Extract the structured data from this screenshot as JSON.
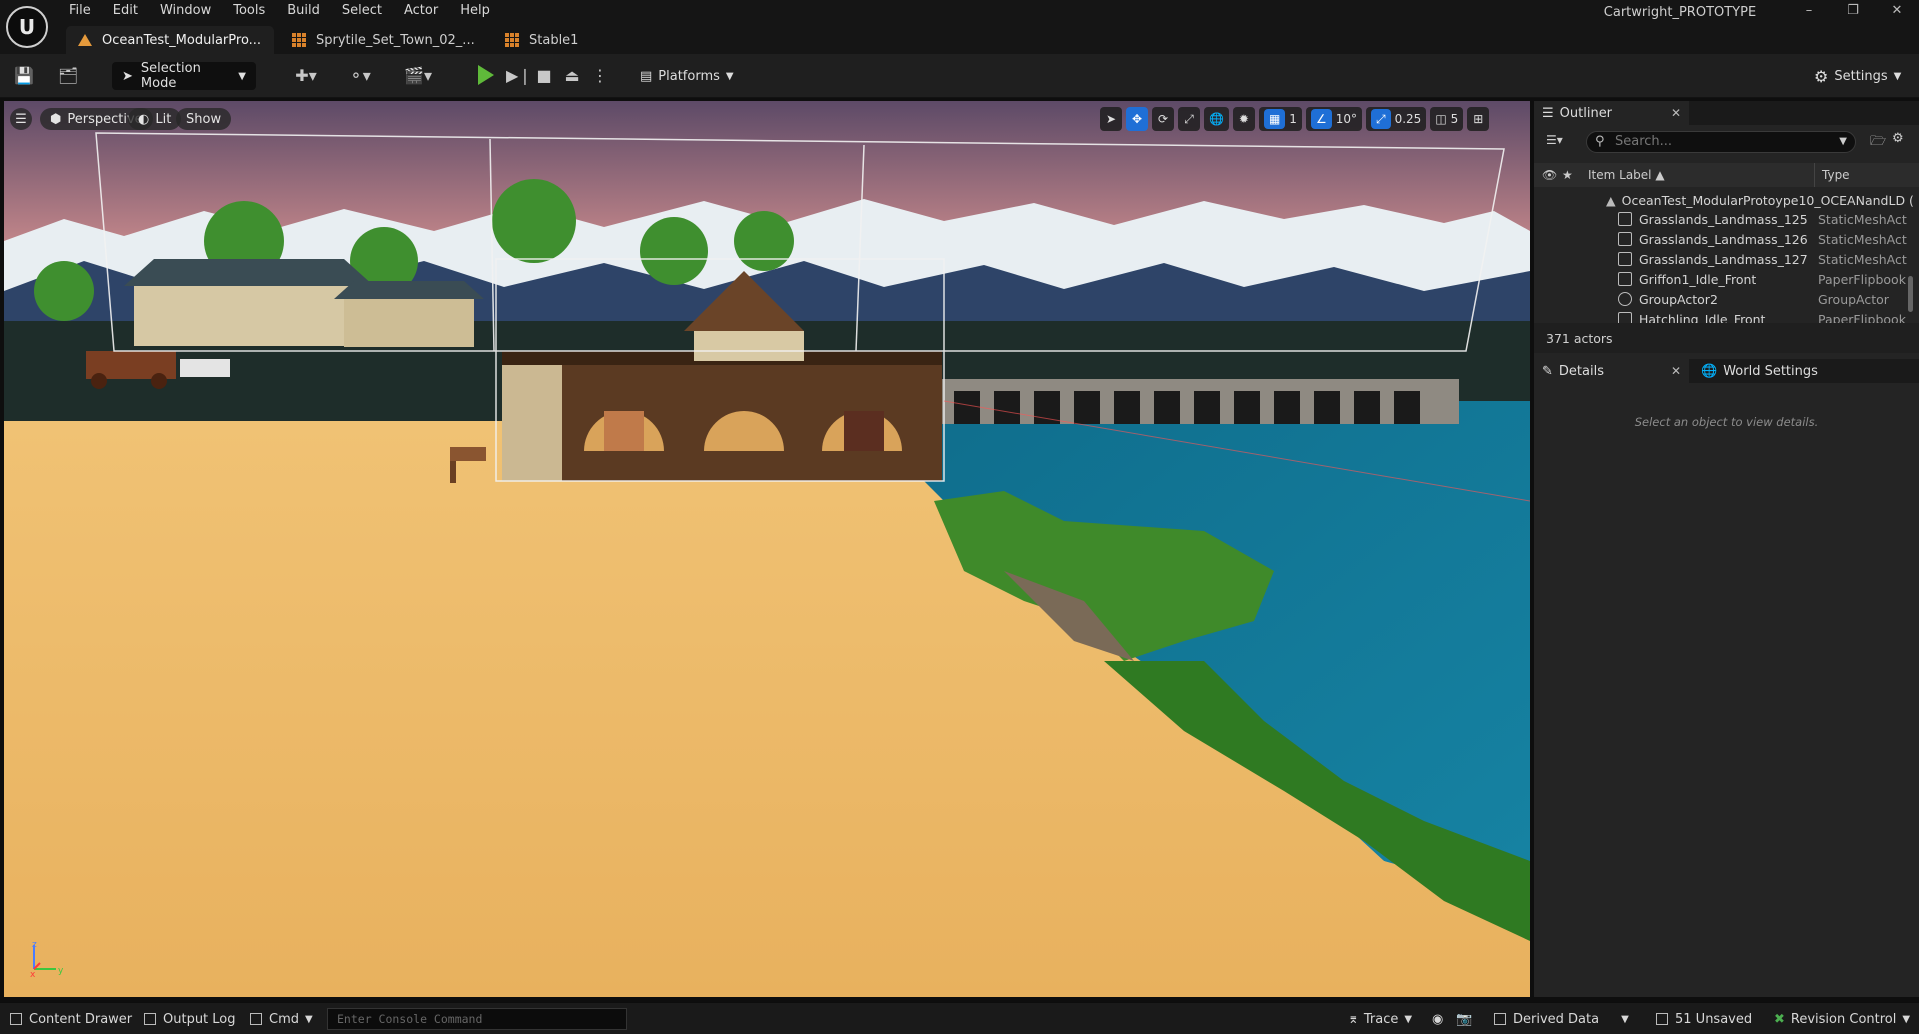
{
  "app": {
    "project_name": "Cartwright_PROTOTYPE",
    "logo_icon": "unreal-logo-icon"
  },
  "menu": [
    "File",
    "Edit",
    "Window",
    "Tools",
    "Build",
    "Select",
    "Actor",
    "Help"
  ],
  "window_controls": [
    "minimize",
    "restore",
    "close"
  ],
  "tabs": [
    {
      "label": "OceanTest_ModularPro...",
      "icon": "level-icon",
      "active": true
    },
    {
      "label": "Sprytile_Set_Town_02_...",
      "icon": "tileset-icon",
      "active": false
    },
    {
      "label": "Stable1",
      "icon": "tileset-icon",
      "active": false
    }
  ],
  "toolbar": {
    "selection_mode": "Selection Mode",
    "platforms": "Platforms",
    "settings": "Settings"
  },
  "viewport": {
    "perspective": "Perspective",
    "lit": "Lit",
    "show": "Show",
    "grid_snap": "1",
    "rotation_snap": "10°",
    "scale_snap": "0.25",
    "camera_speed": "5",
    "axis": {
      "z": "z",
      "x": "x",
      "y": "y"
    }
  },
  "outliner": {
    "title": "Outliner",
    "search_placeholder": "Search...",
    "col_label": "Item Label ▲",
    "col_type": "Type",
    "root": "OceanTest_ModularProtoype10_OCEANandLD (",
    "rows": [
      {
        "label": "Grasslands_Landmass_125",
        "type": "StaticMeshAct"
      },
      {
        "label": "Grasslands_Landmass_126",
        "type": "StaticMeshAct"
      },
      {
        "label": "Grasslands_Landmass_127",
        "type": "StaticMeshAct"
      },
      {
        "label": "Griffon1_Idle_Front",
        "type": "PaperFlipbook"
      },
      {
        "label": "GroupActor2",
        "type": "GroupActor"
      },
      {
        "label": "Hatchling_Idle_Front",
        "type": "PaperFlipbook"
      }
    ],
    "actor_count": "371 actors"
  },
  "details": {
    "tab": "Details",
    "world_settings_tab": "World Settings",
    "empty_msg": "Select an object to view details."
  },
  "statusbar": {
    "content_drawer": "Content Drawer",
    "output_log": "Output Log",
    "cmd": "Cmd",
    "console_placeholder": "Enter Console Command",
    "trace": "Trace",
    "derived_data": "Derived Data",
    "unsaved": "51 Unsaved",
    "revision_control": "Revision Control"
  },
  "colors": {
    "accent": "#1f6fd6",
    "play_green": "#5fba3a",
    "level_orange": "#e59a3c"
  }
}
